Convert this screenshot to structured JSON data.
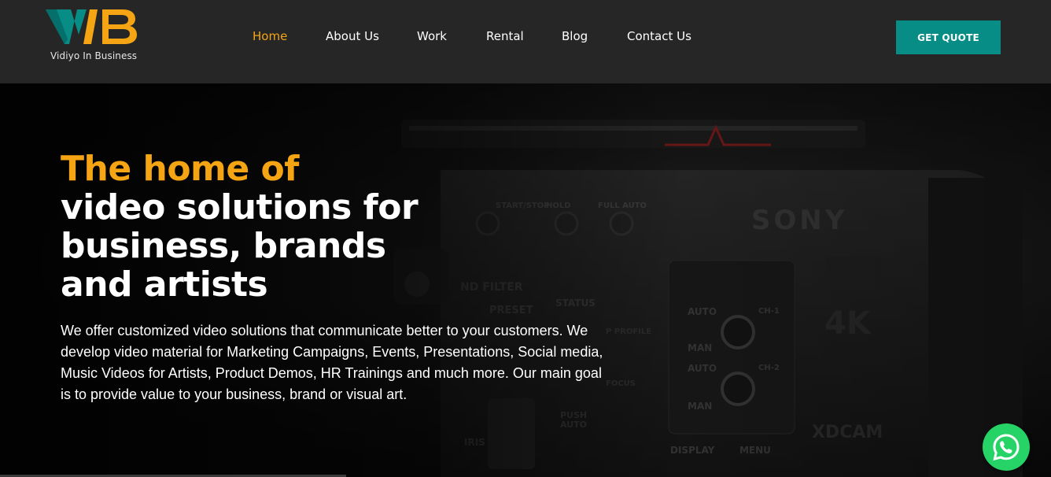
{
  "brand": {
    "logo_letters": "VIB",
    "tagline": "Vidiyo In Business",
    "colors": {
      "teal": "#078c86",
      "orange": "#f5a413"
    }
  },
  "nav": {
    "items": [
      {
        "label": "Home",
        "active": true
      },
      {
        "label": "About Us",
        "active": false
      },
      {
        "label": "Work",
        "active": false
      },
      {
        "label": "Rental",
        "active": false
      },
      {
        "label": "Blog",
        "active": false
      },
      {
        "label": "Contact Us",
        "active": false
      }
    ],
    "cta_label": "GET QUOTE"
  },
  "hero": {
    "headline_accent": "The home of",
    "headline_lines": [
      "video solutions for",
      "business, brands",
      "and artists"
    ],
    "description": "We offer customized video solutions that communicate better to your customers. We develop video material for Marketing Campaigns, Events, Presentations, Social media, Music Videos for Artists, Product Demos, HR Trainings and much more. Our main goal is to provide value to your business, brand or visual art.",
    "background_image": "camera-photo",
    "camera_text": {
      "brand": "SONY",
      "badge": "4K",
      "format": "XDCAM",
      "buttons": [
        "START/STOP",
        "HOLD",
        "FULL AUTO"
      ],
      "nd_filter": "ND FILTER",
      "preset": "PRESET",
      "status": "STATUS",
      "auto": "AUTO",
      "man": "MAN",
      "ch1": "CH-1",
      "ch2": "CH-2",
      "display": "DISPLAY",
      "menu": "MENU",
      "iris": "IRIS",
      "push_auto": "PUSH AUTO",
      "focus": "FOCUS",
      "profile": "P PROFILE"
    }
  },
  "floating": {
    "whatsapp_icon": "whatsapp-icon"
  }
}
